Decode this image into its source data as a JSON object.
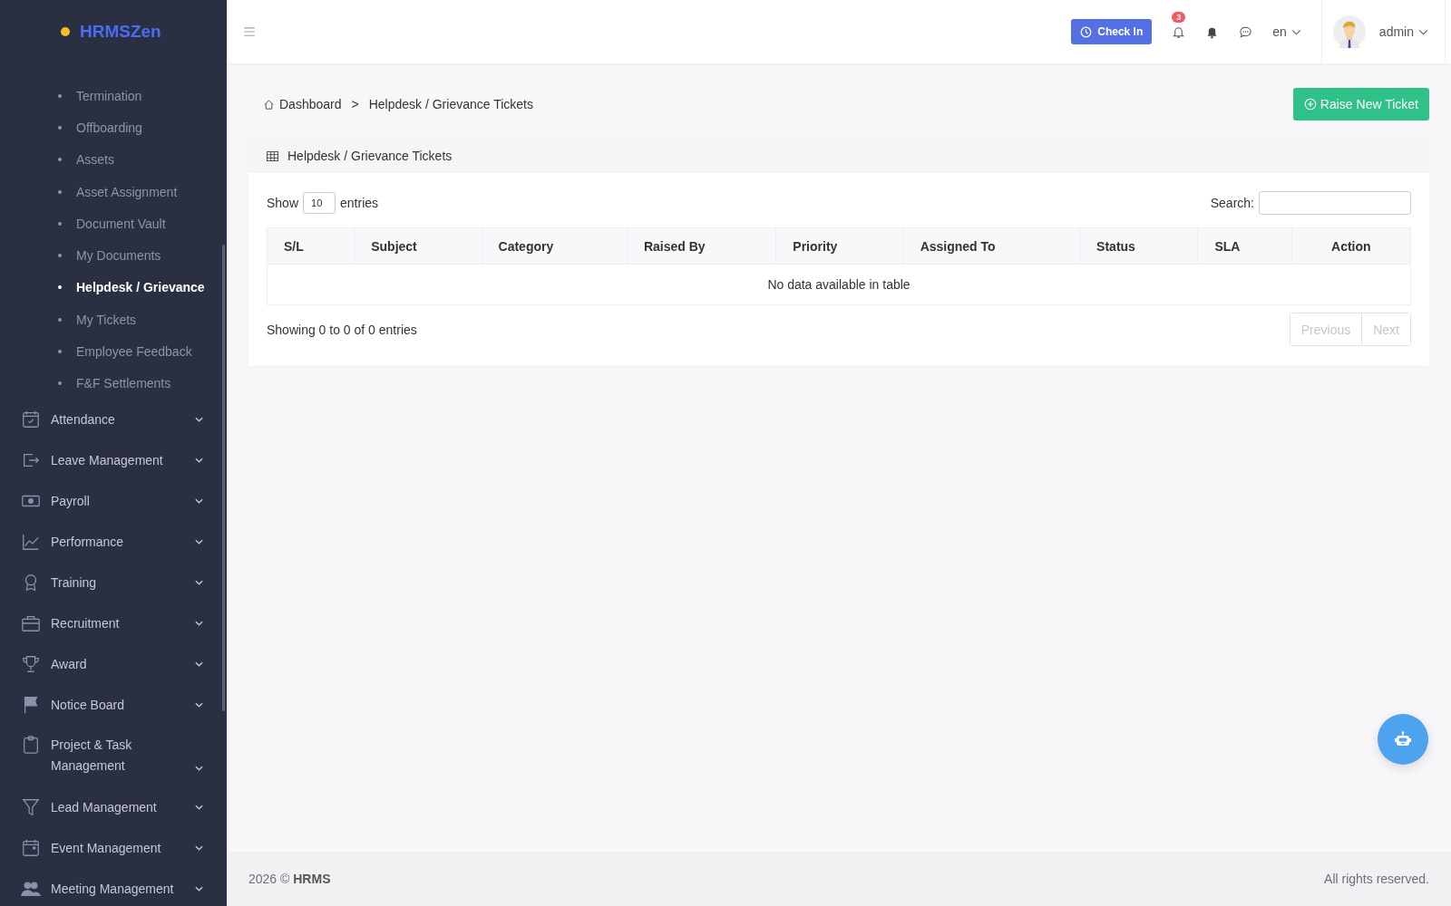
{
  "brand": "HRMSZen",
  "sidebar": {
    "sub_items": [
      {
        "label": "Termination",
        "selected": false
      },
      {
        "label": "Offboarding",
        "selected": false
      },
      {
        "label": "Assets",
        "selected": false
      },
      {
        "label": "Asset Assignment",
        "selected": false
      },
      {
        "label": "Document Vault",
        "selected": false
      },
      {
        "label": "My Documents",
        "selected": false
      },
      {
        "label": "Helpdesk / Grievance",
        "selected": true
      },
      {
        "label": "My Tickets",
        "selected": false
      },
      {
        "label": "Employee Feedback",
        "selected": false
      },
      {
        "label": "F&F Settlements",
        "selected": false
      }
    ],
    "items": [
      {
        "label": "Attendance",
        "expanded": false
      },
      {
        "label": "Leave Management",
        "expanded": false
      },
      {
        "label": "Payroll",
        "expanded": false
      },
      {
        "label": "Performance",
        "expanded": false
      },
      {
        "label": "Training",
        "expanded": false
      },
      {
        "label": "Recruitment",
        "expanded": false
      },
      {
        "label": "Award",
        "expanded": false
      },
      {
        "label": "Notice Board",
        "expanded": false
      },
      {
        "label": "Project & Task Management",
        "expanded": false
      },
      {
        "label": "Lead Management",
        "expanded": false
      },
      {
        "label": "Event Management",
        "expanded": false
      },
      {
        "label": "Meeting Management",
        "expanded": false
      }
    ]
  },
  "topbar": {
    "check_in": "Check In",
    "notification_count": "3",
    "language": "en",
    "user": "admin"
  },
  "breadcrumb": [
    "Dashboard",
    "Helpdesk / Grievance Tickets"
  ],
  "breadcrumb_separator": ">",
  "primary_action": "Raise New Ticket",
  "card": {
    "title": "Helpdesk / Grievance Tickets",
    "show_label": "Show",
    "page_size": "10",
    "entries_label": "entries",
    "search_label": "Search:",
    "columns": [
      "S/L",
      "Subject",
      "Category",
      "Raised By",
      "Priority",
      "Assigned To",
      "Status",
      "SLA",
      "Action"
    ],
    "empty_message": "No data available in table",
    "info": "Showing 0 to 0 of 0 entries",
    "pagination": [
      {
        "label": "Previous",
        "disabled": true
      },
      {
        "label": "Next",
        "disabled": true
      }
    ]
  },
  "footer": {
    "copyright": "2026 © **HRMS**",
    "rights": "All rights reserved."
  }
}
